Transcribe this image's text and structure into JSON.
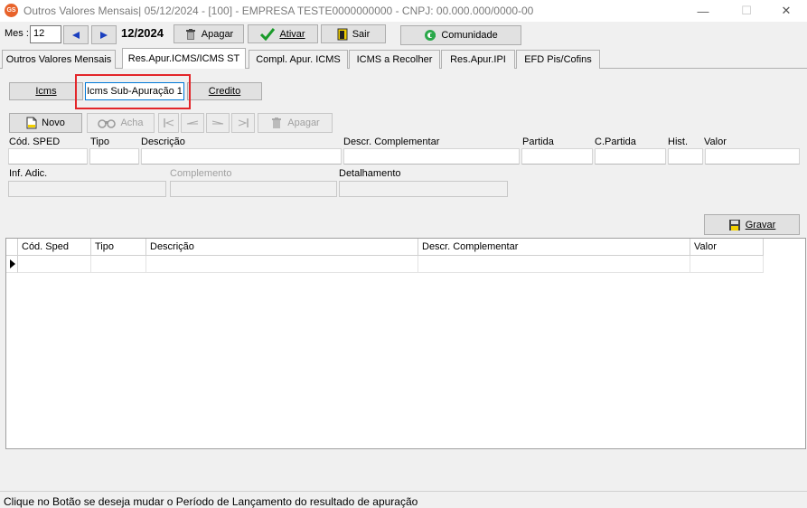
{
  "window": {
    "app_icon_text": "GS",
    "title": "Outros Valores Mensais|  05/12/2024 - [100] - EMPRESA TESTE0000000000 - CNPJ: 00.000.000/0000-00",
    "minimize": "—",
    "maximize": "☐",
    "close": "✕"
  },
  "toolbar": {
    "mes_label": "Mes :",
    "mes_value": "12",
    "period": "12/2024",
    "apagar": "Apagar",
    "ativar": "Ativar",
    "sair": "Sair",
    "comunidade": "Comunidade"
  },
  "tabs": [
    {
      "label": "Outros Valores Mensais",
      "active": false
    },
    {
      "label": "Res.Apur.ICMS/ICMS ST",
      "active": true
    },
    {
      "label": "Compl. Apur. ICMS",
      "active": false
    },
    {
      "label": "ICMS a Recolher",
      "active": false
    },
    {
      "label": "Res.Apur.IPI",
      "active": false
    },
    {
      "label": "EFD Pis/Cofins",
      "active": false
    }
  ],
  "subtabs": {
    "icms": "Icms",
    "icms_sub": "Icms Sub-Apuração 1",
    "credito": "Credito"
  },
  "actions": {
    "novo": "Novo",
    "acha": "Acha",
    "apagar": "Apagar"
  },
  "form": {
    "cod_sped": "Cód. SPED",
    "tipo": "Tipo",
    "descricao": "Descrição",
    "descr_complementar": "Descr. Complementar",
    "partida": "Partida",
    "c_partida": "C.Partida",
    "hist": "Hist.",
    "valor": "Valor",
    "inf_adic": "Inf. Adic.",
    "complemento": "Complemento",
    "detalhamento": "Detalhamento",
    "gravar": "Gravar"
  },
  "grid": {
    "columns": [
      "Cód. Sped",
      "Tipo",
      "Descrição",
      "Descr. Complementar",
      "Valor"
    ]
  },
  "status": {
    "message": "Clique no Botão se deseja mudar o Período de Lançamento do resultado de apuração"
  }
}
